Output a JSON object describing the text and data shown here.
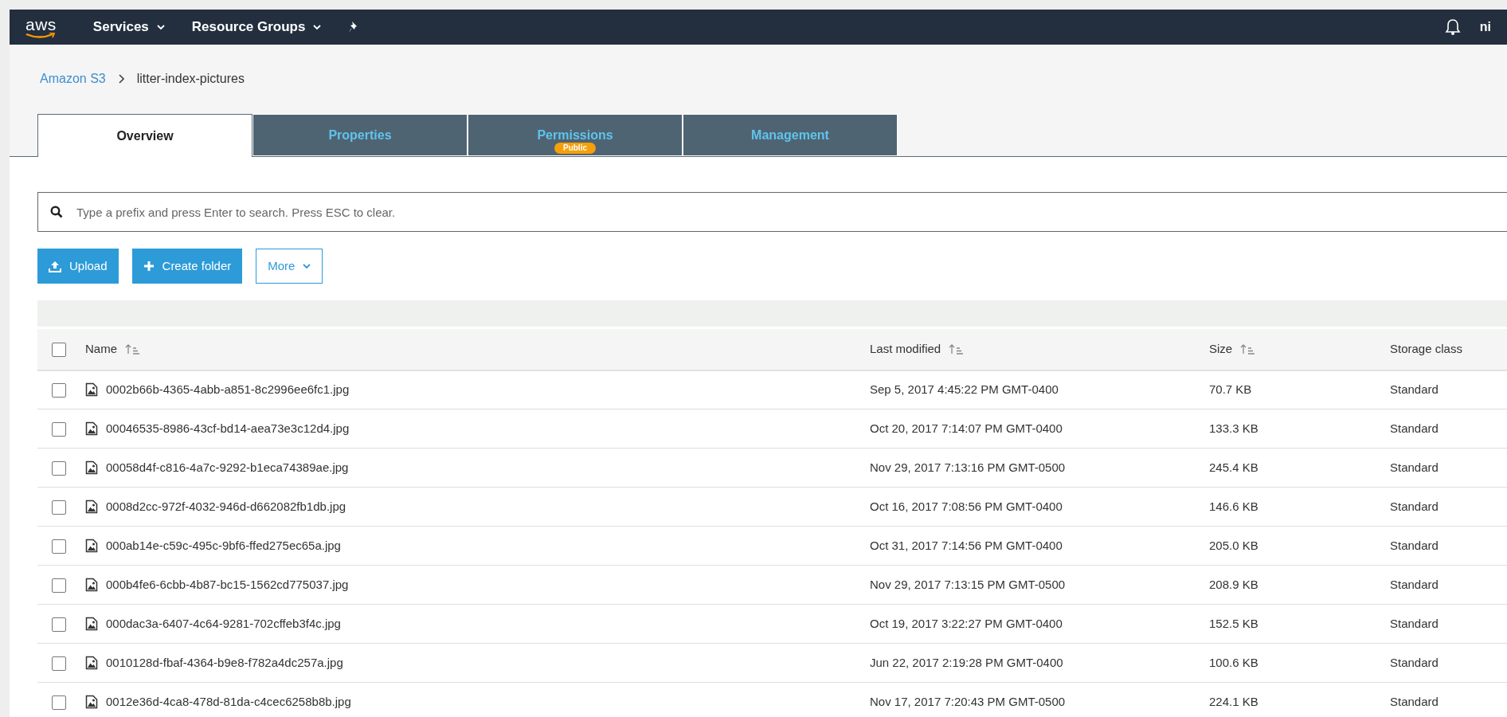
{
  "nav": {
    "logo": "aws",
    "menus": [
      {
        "label": "Services"
      },
      {
        "label": "Resource Groups"
      }
    ],
    "user": "ni"
  },
  "breadcrumb": [
    "Amazon S3",
    "litter-index-pictures"
  ],
  "tabs": [
    {
      "label": "Overview",
      "selected": true
    },
    {
      "label": "Properties",
      "selected": false
    },
    {
      "label": "Permissions",
      "selected": false,
      "badge": "Public"
    },
    {
      "label": "Management",
      "selected": false
    }
  ],
  "search": {
    "placeholder": "Type a prefix and press Enter to search. Press ESC to clear."
  },
  "buttons": [
    {
      "label": "Upload",
      "kind": "upload"
    },
    {
      "label": "Create folder",
      "kind": "create"
    },
    {
      "label": "More",
      "kind": "dropdown"
    }
  ],
  "table": {
    "select_all": {
      "checked": false
    },
    "columns": [
      {
        "label": "Name",
        "sortable": true
      },
      {
        "label": "Last modified",
        "sortable": true
      },
      {
        "label": "Size",
        "sortable": true
      },
      {
        "label": "Storage class",
        "sortable": false
      }
    ],
    "rows": [
      {
        "checked": false,
        "name": "0002b66b-4365-4abb-a851-8c2996ee6fc1.jpg",
        "modified": "Sep 5, 2017 4:45:22 PM GMT-0400",
        "size": "70.7 KB",
        "storage_class": "Standard"
      },
      {
        "checked": false,
        "name": "00046535-8986-43cf-bd14-aea73e3c12d4.jpg",
        "modified": "Oct 20, 2017 7:14:07 PM GMT-0400",
        "size": "133.3 KB",
        "storage_class": "Standard"
      },
      {
        "checked": false,
        "name": "00058d4f-c816-4a7c-9292-b1eca74389ae.jpg",
        "modified": "Nov 29, 2017 7:13:16 PM GMT-0500",
        "size": "245.4 KB",
        "storage_class": "Standard"
      },
      {
        "checked": false,
        "name": "0008d2cc-972f-4032-946d-d662082fb1db.jpg",
        "modified": "Oct 16, 2017 7:08:56 PM GMT-0400",
        "size": "146.6 KB",
        "storage_class": "Standard"
      },
      {
        "checked": false,
        "name": "000ab14e-c59c-495c-9bf6-ffed275ec65a.jpg",
        "modified": "Oct 31, 2017 7:14:56 PM GMT-0400",
        "size": "205.0 KB",
        "storage_class": "Standard"
      },
      {
        "checked": false,
        "name": "000b4fe6-6cbb-4b87-bc15-1562cd775037.jpg",
        "modified": "Nov 29, 2017 7:13:15 PM GMT-0500",
        "size": "208.9 KB",
        "storage_class": "Standard"
      },
      {
        "checked": false,
        "name": "000dac3a-6407-4c64-9281-702cffeb3f4c.jpg",
        "modified": "Oct 19, 2017 3:22:27 PM GMT-0400",
        "size": "152.5 KB",
        "storage_class": "Standard"
      },
      {
        "checked": false,
        "name": "0010128d-fbaf-4364-b9e8-f782a4dc257a.jpg",
        "modified": "Jun 22, 2017 2:19:28 PM GMT-0400",
        "size": "100.6 KB",
        "storage_class": "Standard"
      },
      {
        "checked": false,
        "name": "0012e36d-4ca8-478d-81da-c4cec6258b8b.jpg",
        "modified": "Nov 17, 2017 7:20:43 PM GMT-0500",
        "size": "224.1 KB",
        "storage_class": "Standard"
      }
    ]
  }
}
